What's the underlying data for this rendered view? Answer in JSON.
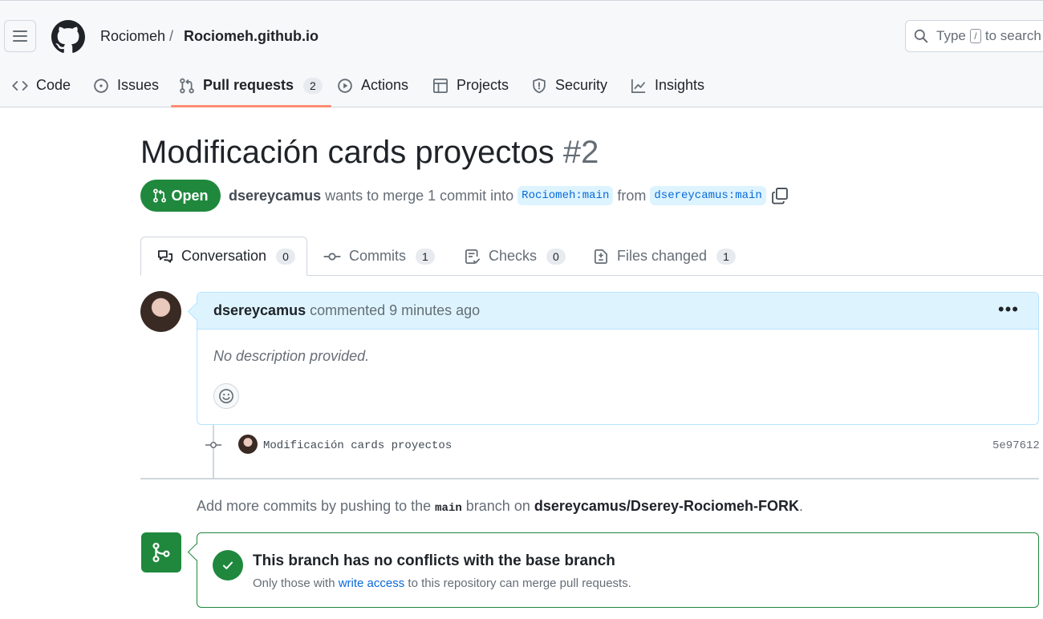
{
  "header": {
    "owner": "Rociomeh",
    "separator": "/",
    "repo": "Rociomeh.github.io",
    "search_prefix": "Type",
    "search_key": "/",
    "search_suffix": "to search"
  },
  "repo_nav": [
    {
      "label": "Code",
      "icon": "code-icon"
    },
    {
      "label": "Issues",
      "icon": "issue-icon"
    },
    {
      "label": "Pull requests",
      "icon": "pull-request-icon",
      "count": "2",
      "active": true
    },
    {
      "label": "Actions",
      "icon": "play-icon"
    },
    {
      "label": "Projects",
      "icon": "table-icon"
    },
    {
      "label": "Security",
      "icon": "shield-icon"
    },
    {
      "label": "Insights",
      "icon": "graph-icon"
    }
  ],
  "pr": {
    "title": "Modificación cards proyectos",
    "number": "#2",
    "state": "Open",
    "author": "dsereycamus",
    "merge_text": "wants to merge 1 commit into",
    "base_branch": "Rociomeh:main",
    "from_text": "from",
    "head_branch": "dsereycamus:main"
  },
  "tabs": [
    {
      "label": "Conversation",
      "count": "0",
      "icon": "comment-discussion-icon",
      "active": true
    },
    {
      "label": "Commits",
      "count": "1",
      "icon": "git-commit-icon"
    },
    {
      "label": "Checks",
      "count": "0",
      "icon": "checklist-icon"
    },
    {
      "label": "Files changed",
      "count": "1",
      "icon": "file-diff-icon"
    }
  ],
  "comment": {
    "author": "dsereycamus",
    "action": "commented",
    "time": "9 minutes ago",
    "body": "No description provided."
  },
  "commit": {
    "message": "Modificación cards proyectos",
    "sha": "5e97612"
  },
  "hint": {
    "prefix": "Add more commits by pushing to the",
    "branch": "main",
    "middle": "branch on",
    "repo": "dsereycamus/Dserey-Rociomeh-FORK",
    "suffix": "."
  },
  "merge": {
    "title": "This branch has no conflicts with the base branch",
    "sub_prefix": "Only those with",
    "sub_link": "write access",
    "sub_suffix": "to this repository can merge pull requests."
  },
  "colors": {
    "accent_green": "#1f883d",
    "link_blue": "#0969da",
    "active_tab_underline": "#fd8c73"
  }
}
